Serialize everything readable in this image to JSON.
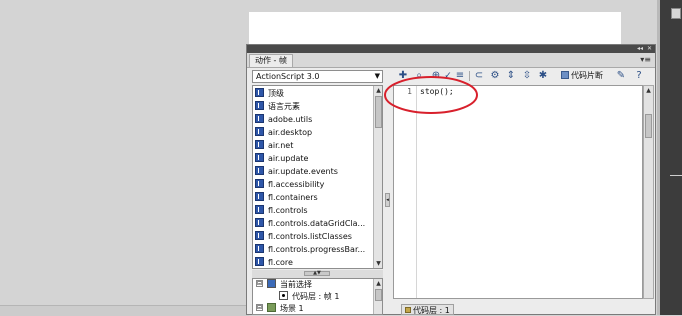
{
  "panel": {
    "tab_label": "动作 - 帧",
    "menu_icon": "panel-menu-icon",
    "window_controls": [
      "collapse-icon",
      "close-icon"
    ]
  },
  "language_select": {
    "value": "ActionScript 3.0"
  },
  "toolbox": {
    "items": [
      {
        "label": "顶级"
      },
      {
        "label": "语言元素"
      },
      {
        "label": "adobe.utils"
      },
      {
        "label": "air.desktop"
      },
      {
        "label": "air.net"
      },
      {
        "label": "air.update"
      },
      {
        "label": "air.update.events"
      },
      {
        "label": "fl.accessibility"
      },
      {
        "label": "fl.containers"
      },
      {
        "label": "fl.controls"
      },
      {
        "label": "fl.controls.dataGridCla..."
      },
      {
        "label": "fl.controls.listClasses"
      },
      {
        "label": "fl.controls.progressBar..."
      },
      {
        "label": "fl.core"
      }
    ]
  },
  "script_navigator": {
    "items": [
      {
        "label": "当前选择",
        "expander": "⊟"
      },
      {
        "label": "代码层 : 帧 1",
        "expander": ""
      },
      {
        "label": "场景 1",
        "expander": "⊟"
      }
    ]
  },
  "toolbar": {
    "tools": [
      "add-icon",
      "find-icon",
      "target-icon",
      "check-syntax-icon",
      "format-icon",
      "code-hint-icon",
      "debug-icon",
      "collapse-between-icon",
      "collapse-selection-icon",
      "expand-all-icon"
    ],
    "snippets_label": "代码片断",
    "wand_icon": "magic-wand-icon",
    "help_icon": "help-icon"
  },
  "editor": {
    "line_number": "1",
    "code": "stop();",
    "highlight_color": "#d8202c"
  },
  "status": {
    "tab_label": "代码层 : 1"
  }
}
